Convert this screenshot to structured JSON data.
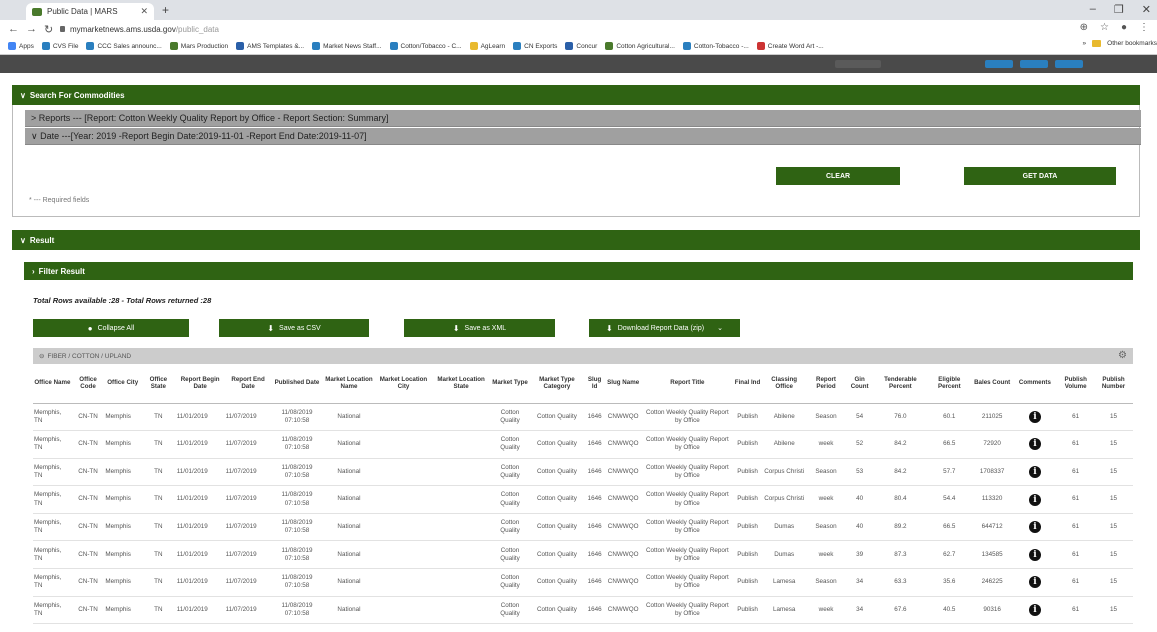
{
  "browser": {
    "tab_title": "Public Data | MARS",
    "url_host": "mymarketnews.ams.usda.gov",
    "url_path": "/public_data",
    "bookmarks": [
      "Apps",
      "CVS File",
      "CCC Sales announc...",
      "Mars Production",
      "AMS Templates &...",
      "Market News Staff...",
      "Cotton/Tobacco - C...",
      "AgLearn",
      "CN Exports",
      "Concur",
      "Cotton Agricultural...",
      "Cotton-Tobacco -...",
      "Create Word Art -..."
    ],
    "other_bookmarks": "Other bookmarks"
  },
  "search": {
    "header": "Search For Commodities",
    "reports_row": "> Reports --- [Report: Cotton Weekly Quality Report by Office - Report Section: Summary]",
    "date_row": "∨ Date ---[Year: 2019 -Report Begin Date:2019-11-01 -Report End Date:2019-11-07]",
    "clear_label": "CLEAR",
    "get_data_label": "GET DATA",
    "required_note": "* --- Required fields"
  },
  "result": {
    "header": "Result",
    "filter_label": "Filter Result",
    "totals": "Total Rows available :28 - Total Rows returned :28",
    "collapse_label": "Collapse All",
    "csv_label": "Save as CSV",
    "xml_label": "Save as XML",
    "zip_label": "Download Report Data (zip)",
    "group_title": "FIBER / COTTON / UPLAND"
  },
  "table": {
    "columns": [
      "Office Name",
      "Office Code",
      "Office City",
      "Office State",
      "Report Begin Date",
      "Report End Date",
      "Published Date",
      "Market Location Name",
      "Market Location City",
      "Market Location State",
      "Market Type",
      "Market Type Category",
      "Slug Id",
      "Slug Name",
      "Report Title",
      "Final Ind",
      "Classing Office",
      "Report Period",
      "Gin Count",
      "Tenderable Percent",
      "Eligible Percent",
      "Bales Count",
      "Comments",
      "Publish Volume",
      "Publish Number"
    ],
    "rows": [
      [
        "Memphis, TN",
        "CN-TN",
        "Memphis",
        "TN",
        "11/01/2019",
        "11/07/2019",
        "11/08/2019 07:10:58",
        "National",
        "",
        "",
        "Cotton Quality",
        "Cotton Quality",
        "1646",
        "CNWWQO",
        "Cotton Weekly Quality Report by Office",
        "Publish",
        "Abilene",
        "Season",
        "54",
        "76.0",
        "60.1",
        "211025",
        "i",
        "61",
        "15"
      ],
      [
        "Memphis, TN",
        "CN-TN",
        "Memphis",
        "TN",
        "11/01/2019",
        "11/07/2019",
        "11/08/2019 07:10:58",
        "National",
        "",
        "",
        "Cotton Quality",
        "Cotton Quality",
        "1646",
        "CNWWQO",
        "Cotton Weekly Quality Report by Office",
        "Publish",
        "Abilene",
        "week",
        "52",
        "84.2",
        "66.5",
        "72920",
        "i",
        "61",
        "15"
      ],
      [
        "Memphis, TN",
        "CN-TN",
        "Memphis",
        "TN",
        "11/01/2019",
        "11/07/2019",
        "11/08/2019 07:10:58",
        "National",
        "",
        "",
        "Cotton Quality",
        "Cotton Quality",
        "1646",
        "CNWWQO",
        "Cotton Weekly Quality Report by Office",
        "Publish",
        "Corpus Christi",
        "Season",
        "53",
        "84.2",
        "57.7",
        "1708337",
        "i",
        "61",
        "15"
      ],
      [
        "Memphis, TN",
        "CN-TN",
        "Memphis",
        "TN",
        "11/01/2019",
        "11/07/2019",
        "11/08/2019 07:10:58",
        "National",
        "",
        "",
        "Cotton Quality",
        "Cotton Quality",
        "1646",
        "CNWWQO",
        "Cotton Weekly Quality Report by Office",
        "Publish",
        "Corpus Christi",
        "week",
        "40",
        "80.4",
        "54.4",
        "113320",
        "i",
        "61",
        "15"
      ],
      [
        "Memphis, TN",
        "CN-TN",
        "Memphis",
        "TN",
        "11/01/2019",
        "11/07/2019",
        "11/08/2019 07:10:58",
        "National",
        "",
        "",
        "Cotton Quality",
        "Cotton Quality",
        "1646",
        "CNWWQO",
        "Cotton Weekly Quality Report by Office",
        "Publish",
        "Dumas",
        "Season",
        "40",
        "89.2",
        "66.5",
        "644712",
        "i",
        "61",
        "15"
      ],
      [
        "Memphis, TN",
        "CN-TN",
        "Memphis",
        "TN",
        "11/01/2019",
        "11/07/2019",
        "11/08/2019 07:10:58",
        "National",
        "",
        "",
        "Cotton Quality",
        "Cotton Quality",
        "1646",
        "CNWWQO",
        "Cotton Weekly Quality Report by Office",
        "Publish",
        "Dumas",
        "week",
        "39",
        "87.3",
        "62.7",
        "134585",
        "i",
        "61",
        "15"
      ],
      [
        "Memphis, TN",
        "CN-TN",
        "Memphis",
        "TN",
        "11/01/2019",
        "11/07/2019",
        "11/08/2019 07:10:58",
        "National",
        "",
        "",
        "Cotton Quality",
        "Cotton Quality",
        "1646",
        "CNWWQO",
        "Cotton Weekly Quality Report by Office",
        "Publish",
        "Lamesa",
        "Season",
        "34",
        "63.3",
        "35.6",
        "246225",
        "i",
        "61",
        "15"
      ],
      [
        "Memphis, TN",
        "CN-TN",
        "Memphis",
        "TN",
        "11/01/2019",
        "11/07/2019",
        "11/08/2019 07:10:58",
        "National",
        "",
        "",
        "Cotton Quality",
        "Cotton Quality",
        "1646",
        "CNWWQO",
        "Cotton Weekly Quality Report by Office",
        "Publish",
        "Lamesa",
        "week",
        "34",
        "67.6",
        "40.5",
        "90316",
        "i",
        "61",
        "15"
      ]
    ]
  }
}
